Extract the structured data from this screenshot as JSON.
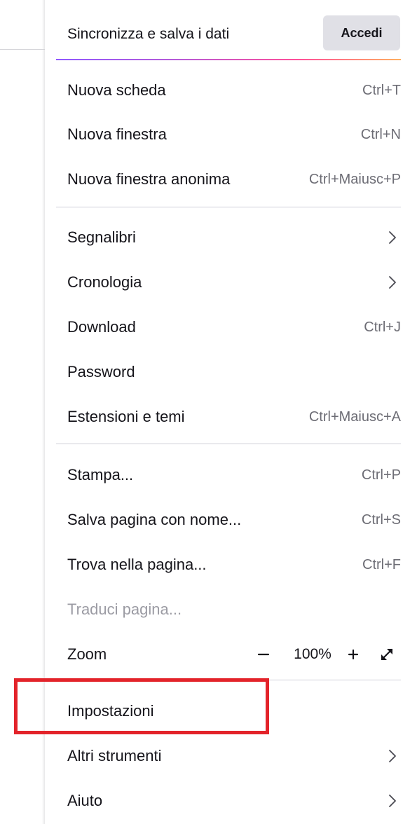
{
  "sync": {
    "title": "Sincronizza e salva i dati",
    "signin_label": "Accedi"
  },
  "menu": {
    "items": [
      {
        "id": "new-tab",
        "label": "Nuova scheda",
        "shortcut": "Ctrl+T"
      },
      {
        "id": "new-window",
        "label": "Nuova finestra",
        "shortcut": "Ctrl+N"
      },
      {
        "id": "new-private-window",
        "label": "Nuova finestra anonima",
        "shortcut": "Ctrl+Maiusc+P"
      },
      {
        "id": "bookmarks",
        "label": "Segnalibri",
        "icon": "chevron-right-icon"
      },
      {
        "id": "history",
        "label": "Cronologia",
        "icon": "chevron-right-icon"
      },
      {
        "id": "downloads",
        "label": "Download",
        "shortcut": "Ctrl+J"
      },
      {
        "id": "passwords",
        "label": "Password"
      },
      {
        "id": "addons",
        "label": "Estensioni e temi",
        "shortcut": "Ctrl+Maiusc+A"
      },
      {
        "id": "print",
        "label": "Stampa...",
        "shortcut": "Ctrl+P"
      },
      {
        "id": "save-page",
        "label": "Salva pagina con nome...",
        "shortcut": "Ctrl+S"
      },
      {
        "id": "find",
        "label": "Trova nella pagina...",
        "shortcut": "Ctrl+F"
      },
      {
        "id": "translate",
        "label": "Traduci pagina...",
        "disabled": true
      },
      {
        "id": "zoom",
        "label": "Zoom"
      },
      {
        "id": "settings",
        "label": "Impostazioni"
      },
      {
        "id": "more-tools",
        "label": "Altri strumenti",
        "icon": "chevron-right-icon"
      },
      {
        "id": "help",
        "label": "Aiuto",
        "icon": "chevron-right-icon"
      }
    ]
  },
  "zoom": {
    "value": "100%",
    "icons": [
      "minus-icon",
      "plus-icon",
      "fullscreen-icon"
    ]
  },
  "colors": {
    "accent_gradient": [
      "#9059ff",
      "#ff4f9a",
      "#ffb060"
    ],
    "highlight": "#e3232a",
    "text": "#15141a",
    "shortcut_text": "#6d6d75",
    "disabled_text": "#9b9ba3",
    "button_bg": "#e0e0e6"
  }
}
